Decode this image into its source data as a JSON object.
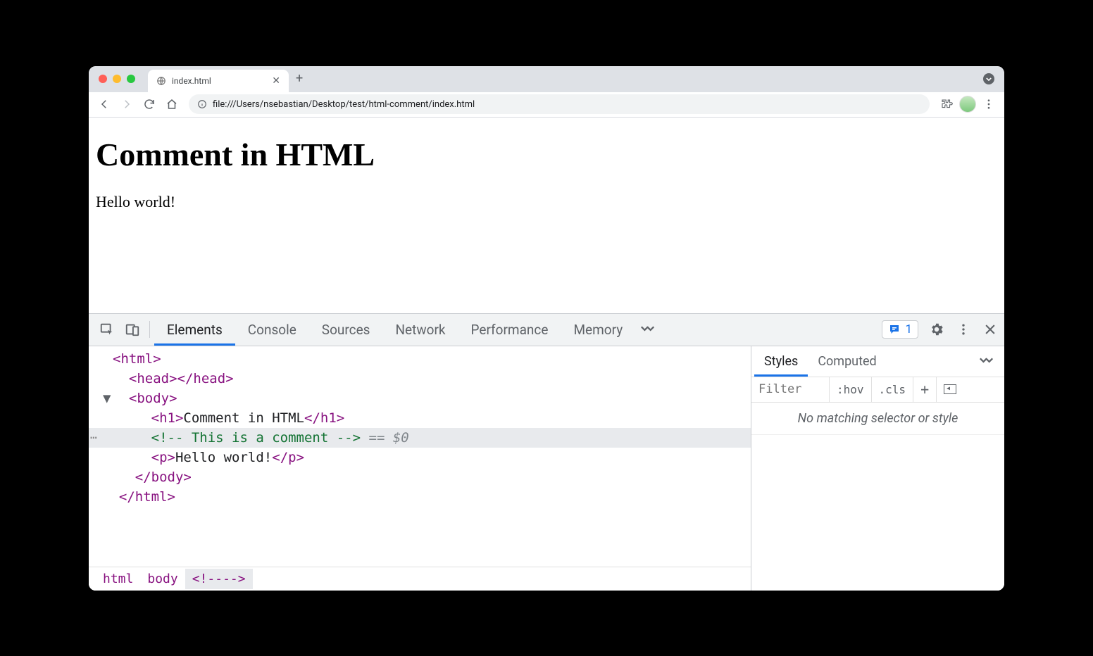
{
  "browser": {
    "tab_title": "index.html",
    "url": "file:///Users/nsebastian/Desktop/test/html-comment/index.html",
    "new_tab_label": "+"
  },
  "page": {
    "heading": "Comment in HTML",
    "paragraph": "Hello world!"
  },
  "devtools": {
    "tabs": {
      "elements": "Elements",
      "console": "Console",
      "sources": "Sources",
      "network": "Network",
      "performance": "Performance",
      "memory": "Memory"
    },
    "issues_count": "1",
    "dom": {
      "html_open": "<html>",
      "head": "<head></head>",
      "body_open": "<body>",
      "h1_open": "<h1>",
      "h1_text": "Comment in HTML",
      "h1_close": "</h1>",
      "comment": "<!-- This is a comment -->",
      "eq": " == ",
      "dollar": "$0",
      "p_open": "<p>",
      "p_text": "Hello world!",
      "p_close": "</p>",
      "body_close": "</body>",
      "html_close": "</html>"
    },
    "crumbs": {
      "html": "html",
      "body": "body",
      "comment": "<!--​-->"
    },
    "styles": {
      "tab_styles": "Styles",
      "tab_computed": "Computed",
      "filter_placeholder": "Filter",
      "hov": ":hov",
      "cls": ".cls",
      "no_match": "No matching selector or style"
    }
  }
}
